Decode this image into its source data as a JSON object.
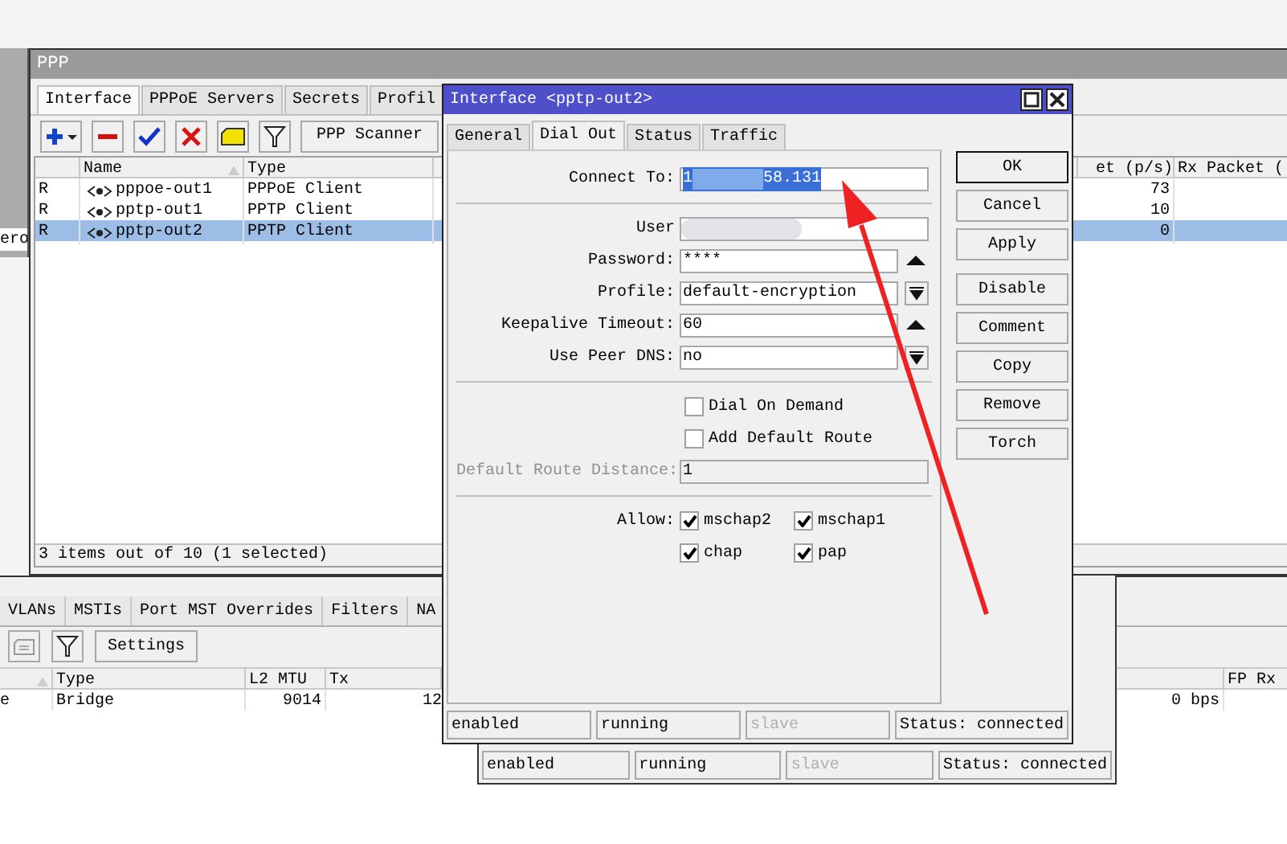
{
  "left_window": {
    "cell": "ero"
  },
  "ppp_window": {
    "title": "PPP",
    "tabs": [
      {
        "label": "Interface",
        "selected": true
      },
      {
        "label": "PPPoE Servers",
        "selected": false
      },
      {
        "label": "Secrets",
        "selected": false
      },
      {
        "label": "Profil",
        "selected": false
      }
    ],
    "scanner_button": "PPP Scanner",
    "columns": [
      "Name",
      "Type",
      "et (p/s)",
      "Rx Packet ("
    ],
    "rows": [
      {
        "flag": "R",
        "name": "pppoe-out1",
        "type": "PPPoE Client",
        "column_5": "73",
        "selected": false
      },
      {
        "flag": "R",
        "name": "pptp-out1",
        "type": "PPTP Client",
        "column_5": "10",
        "selected": false
      },
      {
        "flag": "R",
        "name": "pptp-out2",
        "type": "PPTP Client",
        "column_5": "0",
        "selected": true
      }
    ],
    "status": "3 items out of 10 (1 selected)"
  },
  "bridge_window": {
    "tabs": [
      {
        "label": "VLANs",
        "selected": false
      },
      {
        "label": "MSTIs",
        "selected": false
      },
      {
        "label": "Port MST Overrides",
        "selected": false
      },
      {
        "label": "Filters",
        "selected": false
      },
      {
        "label": "NA",
        "selected": false
      }
    ],
    "settings_button": "Settings",
    "columns": [
      "Type",
      "L2 MTU",
      "Tx",
      "FP Rx"
    ],
    "row": {
      "column_1": "e",
      "type": "Bridge",
      "l2_mtu": "9014",
      "tx": "12",
      "column_5": "0 bps"
    }
  },
  "back_dialog": {
    "status_bar": [
      {
        "text": "enabled",
        "disabled": false
      },
      {
        "text": "running",
        "disabled": false
      },
      {
        "text": "slave",
        "disabled": true
      },
      {
        "text": "Status: connected",
        "disabled": false
      }
    ]
  },
  "dialog": {
    "title": "Interface <pptp-out2>",
    "tabs": [
      {
        "label": "General",
        "selected": false
      },
      {
        "label": "Dial Out",
        "selected": true
      },
      {
        "label": "Status",
        "selected": false
      },
      {
        "label": "Traffic",
        "selected": false
      }
    ],
    "connect_to": {
      "label": "Connect To:",
      "value_start": "1",
      "value_end": "58.131"
    },
    "user": {
      "label": "User"
    },
    "fields": [
      {
        "label": "Password:",
        "value": "****",
        "kind": "spin"
      },
      {
        "label": "Profile:",
        "value": "default-encryption",
        "kind": "dropdown"
      },
      {
        "label": "Keepalive Timeout:",
        "value": "60",
        "kind": "spin"
      },
      {
        "label": "Use Peer DNS:",
        "value": "no",
        "kind": "dropdown"
      }
    ],
    "checkboxes": [
      {
        "label": "Dial On Demand",
        "checked": false
      },
      {
        "label": "Add Default Route",
        "checked": false
      }
    ],
    "route_distance": {
      "label": "Default Route Distance:",
      "value": "1",
      "disabled": true
    },
    "allow": {
      "label": "Allow:",
      "options": [
        {
          "label": "mschap2",
          "checked": true
        },
        {
          "label": "mschap1",
          "checked": true
        },
        {
          "label": "chap",
          "checked": true
        },
        {
          "label": "pap",
          "checked": true
        }
      ]
    },
    "buttons": [
      {
        "label": "OK",
        "default": true
      },
      {
        "label": "Cancel",
        "default": false
      },
      {
        "label": "Apply",
        "default": false
      },
      {
        "label": "Disable",
        "default": false
      },
      {
        "label": "Comment",
        "default": false
      },
      {
        "label": "Copy",
        "default": false
      },
      {
        "label": "Remove",
        "default": false
      },
      {
        "label": "Torch",
        "default": false
      }
    ],
    "status_bar": [
      {
        "text": "enabled",
        "disabled": false
      },
      {
        "text": "running",
        "disabled": false
      },
      {
        "text": "slave",
        "disabled": true
      },
      {
        "text": "Status: connected",
        "disabled": false
      }
    ]
  }
}
